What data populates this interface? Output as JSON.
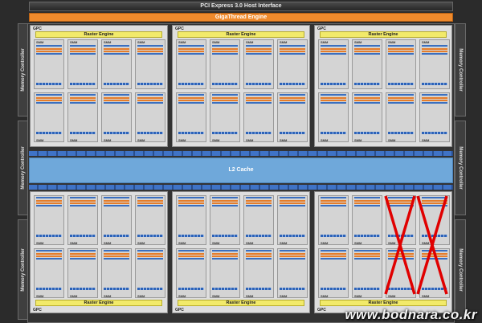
{
  "header": {
    "host_interface": "PCI Express 3.0 Host Interface",
    "giga_thread": "GigaThread Engine"
  },
  "memory_controller_label": "Memory Controller",
  "gpc_label": "GPC",
  "raster_label": "Raster Engine",
  "smm_label": "SMM",
  "l2_label": "L2 Cache",
  "watermark": "www.bodnara.co.kr",
  "disabled_smm_count": 2,
  "colors": {
    "orange_bar": "#ef8a2c",
    "raster": "#f2ea6a",
    "cuda_core": "#3fb43a",
    "l2": "#6fa8da",
    "cross": "#e00000"
  }
}
